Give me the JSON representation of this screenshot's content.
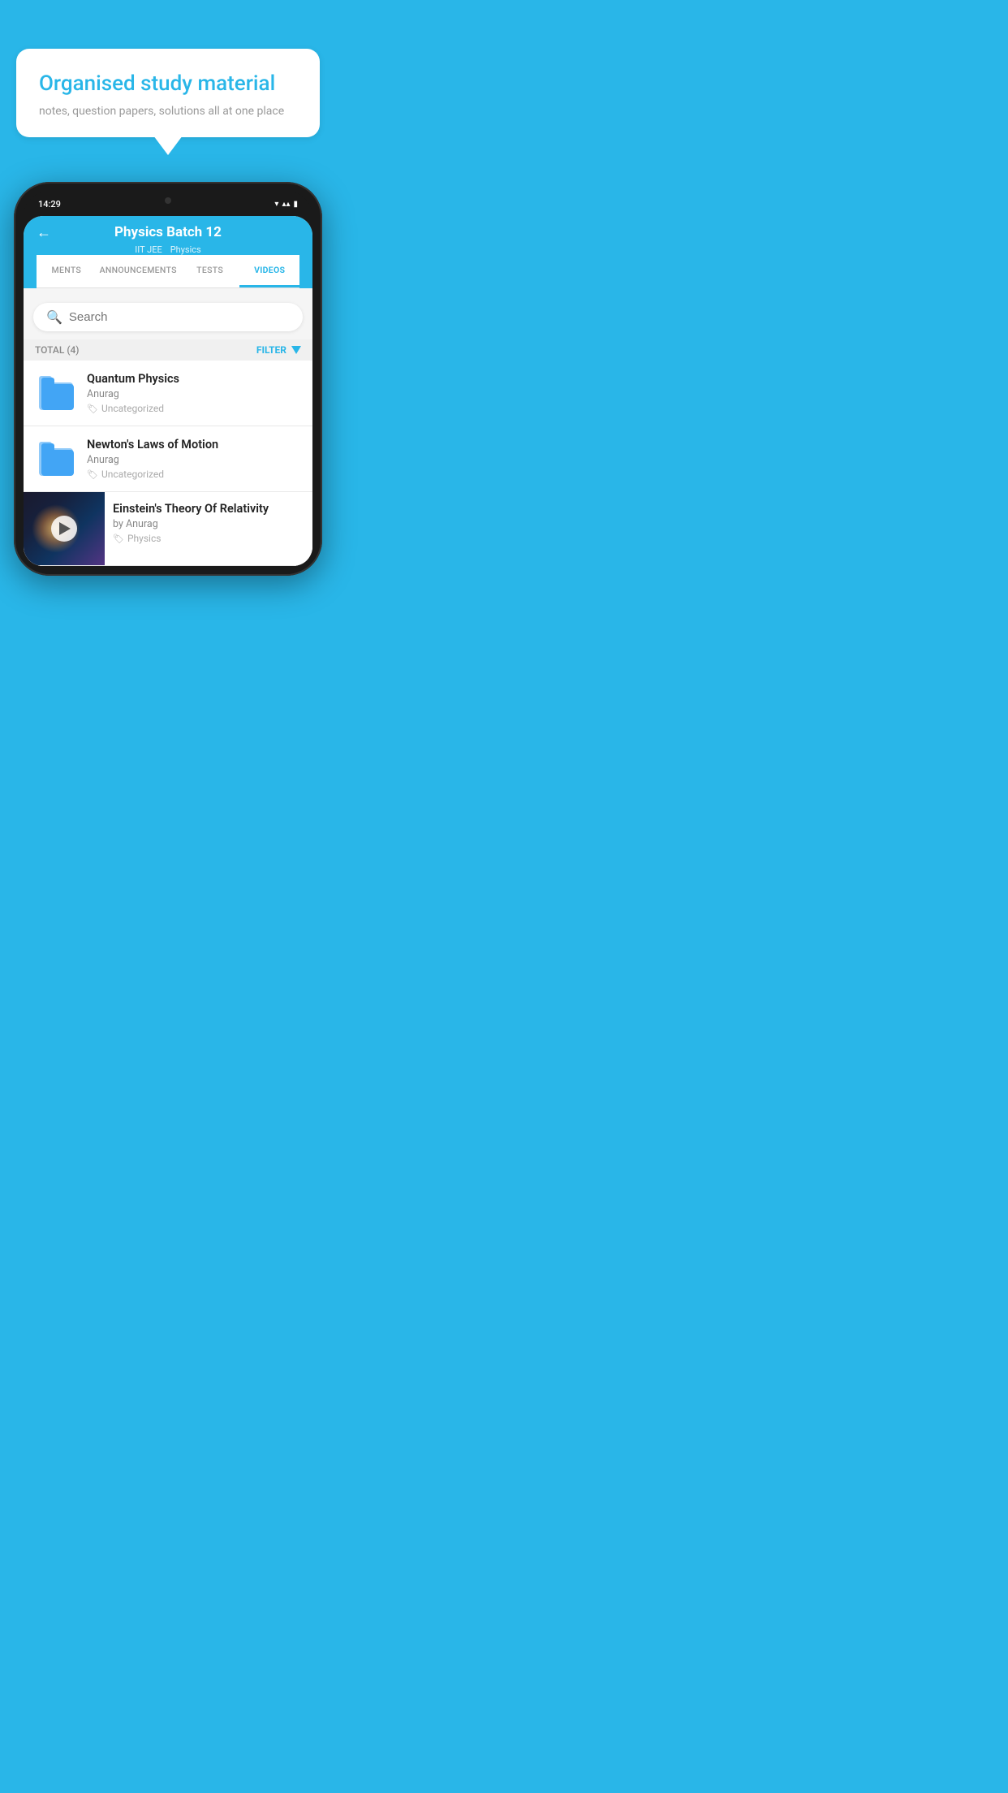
{
  "background": "#29B6E8",
  "bubble": {
    "title": "Organised study material",
    "subtitle": "notes, question papers, solutions all at one place"
  },
  "phone": {
    "status_time": "14:29",
    "header": {
      "title": "Physics Batch 12",
      "subtitle1": "IIT JEE",
      "subtitle2": "Physics",
      "back_label": "←"
    },
    "tabs": [
      {
        "label": "MENTS",
        "active": false
      },
      {
        "label": "ANNOUNCEMENTS",
        "active": false
      },
      {
        "label": "TESTS",
        "active": false
      },
      {
        "label": "VIDEOS",
        "active": true
      }
    ],
    "search": {
      "placeholder": "Search"
    },
    "filter": {
      "total_label": "TOTAL (4)",
      "filter_label": "FILTER"
    },
    "videos": [
      {
        "id": 1,
        "title": "Quantum Physics",
        "author": "Anurag",
        "tag": "Uncategorized",
        "type": "folder",
        "has_thumb": false
      },
      {
        "id": 2,
        "title": "Newton's Laws of Motion",
        "author": "Anurag",
        "tag": "Uncategorized",
        "type": "folder",
        "has_thumb": false
      },
      {
        "id": 3,
        "title": "Einstein's Theory Of Relativity",
        "author": "by Anurag",
        "tag": "Physics",
        "type": "video",
        "has_thumb": true
      }
    ]
  }
}
